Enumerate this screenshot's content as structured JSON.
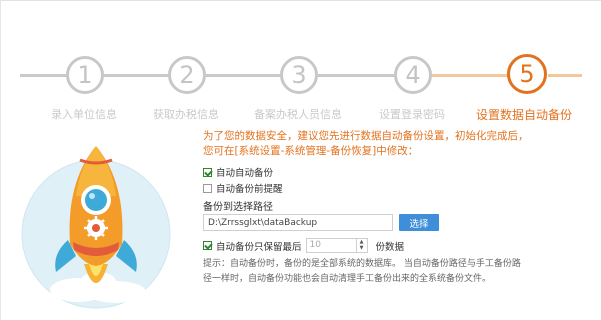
{
  "steps": [
    {
      "number": "1",
      "label": "录入单位信息",
      "active": false
    },
    {
      "number": "2",
      "label": "获取办税信息",
      "active": false
    },
    {
      "number": "3",
      "label": "备案办税人员信息",
      "active": false
    },
    {
      "number": "4",
      "label": "设置登录密码",
      "active": false
    },
    {
      "number": "5",
      "label": "设置数据自动备份",
      "active": true
    }
  ],
  "notice": "为了您的数据安全，建议您先进行数据自动备份设置，初始化完成后，您可在[系统设置-系统管理-备份恢复]中修改：",
  "options": {
    "auto_backup": {
      "label": "自动自动备份",
      "checked": true
    },
    "remind_before": {
      "label": "自动备份前提醒",
      "checked": false
    }
  },
  "path": {
    "label": "备份到选择路径",
    "value": "D:\\Zrrssglxt\\dataBackup",
    "browse_label": "选择"
  },
  "keep": {
    "label": "自动备份只保留最后",
    "value": "10",
    "suffix": "份数据",
    "checked": true
  },
  "hint": "提示：自动备份时，备份的是全部系统的数据库。 当自动备份路径与手工备份路径一样时，自动备份功能也会自动清理手工备份出来的全系统备份文件。",
  "colors": {
    "accent": "#e3721e",
    "inactive": "#c8c8c8",
    "button": "#3e8ed9"
  }
}
